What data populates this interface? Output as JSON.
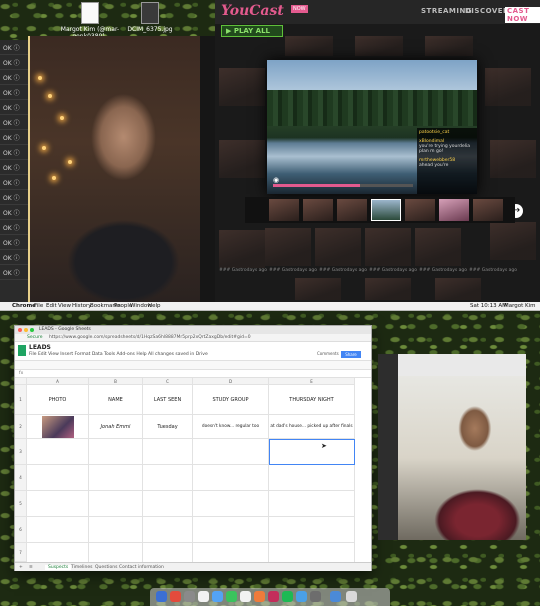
{
  "desktop_top": {
    "icons": [
      {
        "label": "Margot Kim (@mar-gonk0380)_ Twitt...nk.webloc"
      },
      {
        "label": "DCIM_6375.jpg"
      }
    ],
    "partial_labels": [
      "ize.zip",
      "ll_ooth",
      "hbiei",
      "ll_ooth"
    ]
  },
  "side_list": {
    "items": [
      "OK",
      "OK",
      "OK",
      "OK",
      "OK",
      "OK",
      "OK",
      "OK",
      "OK",
      "OK",
      "OK",
      "OK",
      "OK",
      "OK",
      "OK",
      "OK"
    ]
  },
  "youcast": {
    "logo": "YouCast",
    "logo_badge": "NOW",
    "nav": [
      "STREAMING",
      "DISCOVER",
      "CAST NOW"
    ],
    "play_all": "▶ PLAY ALL",
    "chat": [
      {
        "user": "patootsie_cat",
        "text": ""
      },
      {
        "user": "xBlondimal",
        "text": "you're trying yourdelia plan m go!"
      },
      {
        "user": "mrthewebber58",
        "text": "ahead you're"
      }
    ],
    "progress": 0.62,
    "row_meta": [
      "### Gastrodays ago",
      "### Gastrodays ago",
      "### Gastrodays ago",
      "### Gastrodays ago",
      "### Gastrodays ago",
      "### Gastrodays ago"
    ]
  },
  "menubar": {
    "items": [
      "Chrome",
      "File",
      "Edit",
      "View",
      "History",
      "Bookmarks",
      "People",
      "Window",
      "Help"
    ],
    "clock": "Sat 10:13 AM",
    "user": "Margot Kim"
  },
  "sheets": {
    "tab_title": "LEADS - Google Sheets",
    "url": "https://www.google.com/spreadsheets/d/1HqzSa6hl8887Mr5prp2xQrtZaxgDb/edit#gid=0",
    "secure_label": "Secure",
    "doc_title": "LEADS",
    "menu": "File  Edit  View  Insert  Format  Data  Tools  Add-ons  Help   All changes saved in Drive",
    "share_label": "Share",
    "comments_label": "Comments",
    "fx": "fx",
    "columns": [
      "A",
      "B",
      "C",
      "D",
      "E"
    ],
    "headers": [
      "PHOTO",
      "NAME",
      "LAST SEEN",
      "STUDY GROUP",
      "THURSDAY NIGHT"
    ],
    "rows": [
      [
        "",
        "Jonah Emmi",
        "Tuesday",
        "doesn't know... regular too",
        "at dad's house... picked up after finals"
      ]
    ],
    "row_numbers": [
      "1",
      "2",
      "3",
      "4",
      "5",
      "6",
      "7"
    ],
    "sheet_tabs": [
      "Suspects",
      "Timelines",
      "Questions",
      "Contact information"
    ]
  }
}
